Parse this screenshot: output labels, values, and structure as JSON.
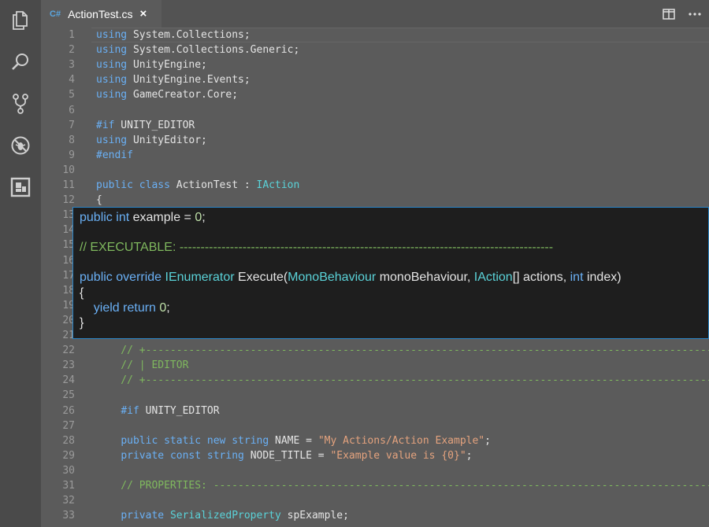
{
  "tab": {
    "lang_badge": "C#",
    "filename": "ActionTest.cs",
    "close": "×"
  },
  "activity_icons": [
    "files-icon",
    "search-icon",
    "source-control-icon",
    "debug-icon",
    "extensions-icon"
  ],
  "lines": [
    {
      "n": "1",
      "t": "using System.Collections;"
    },
    {
      "n": "2",
      "t": "using System.Collections.Generic;"
    },
    {
      "n": "3",
      "t": "using UnityEngine;"
    },
    {
      "n": "4",
      "t": "using UnityEngine.Events;"
    },
    {
      "n": "5",
      "t": "using GameCreator.Core;"
    },
    {
      "n": "6",
      "t": ""
    },
    {
      "n": "7",
      "t": "#if UNITY_EDITOR"
    },
    {
      "n": "8",
      "t": "using UnityEditor;"
    },
    {
      "n": "9",
      "t": "#endif"
    },
    {
      "n": "10",
      "t": ""
    },
    {
      "n": "11",
      "t": "public class ActionTest : IAction"
    },
    {
      "n": "12",
      "t": "{"
    },
    {
      "n": "13",
      "t": ""
    },
    {
      "n": "14",
      "t": ""
    },
    {
      "n": "15",
      "t": ""
    },
    {
      "n": "16",
      "t": ""
    },
    {
      "n": "17",
      "t": ""
    },
    {
      "n": "18",
      "t": ""
    },
    {
      "n": "19",
      "t": ""
    },
    {
      "n": "20",
      "t": ""
    },
    {
      "n": "21",
      "t": ""
    },
    {
      "n": "22",
      "t": "    // +-----------------------------------------------------------------------------------------------"
    },
    {
      "n": "23",
      "t": "    // | EDITOR"
    },
    {
      "n": "24",
      "t": "    // +-----------------------------------------------------------------------------------------------"
    },
    {
      "n": "25",
      "t": ""
    },
    {
      "n": "26",
      "t": "    #if UNITY_EDITOR"
    },
    {
      "n": "27",
      "t": ""
    },
    {
      "n": "28",
      "t": "    public static new string NAME = \"My Actions/Action Example\";"
    },
    {
      "n": "29",
      "t": "    private const string NODE_TITLE = \"Example value is {0}\";"
    },
    {
      "n": "30",
      "t": ""
    },
    {
      "n": "31",
      "t": "    // PROPERTIES: -------------------------------------------------------------------------------------"
    },
    {
      "n": "32",
      "t": ""
    },
    {
      "n": "33",
      "t": "    private SerializedProperty spExample;"
    }
  ],
  "overlay_lines": [
    "public int example = 0;",
    "",
    "// EXECUTABLE: -----------------------------------------------------------------------------------------",
    "",
    "public override IEnumerator Execute(MonoBehaviour monoBehaviour, IAction[] actions, int index)",
    "{",
    "    yield return 0;",
    "}"
  ]
}
